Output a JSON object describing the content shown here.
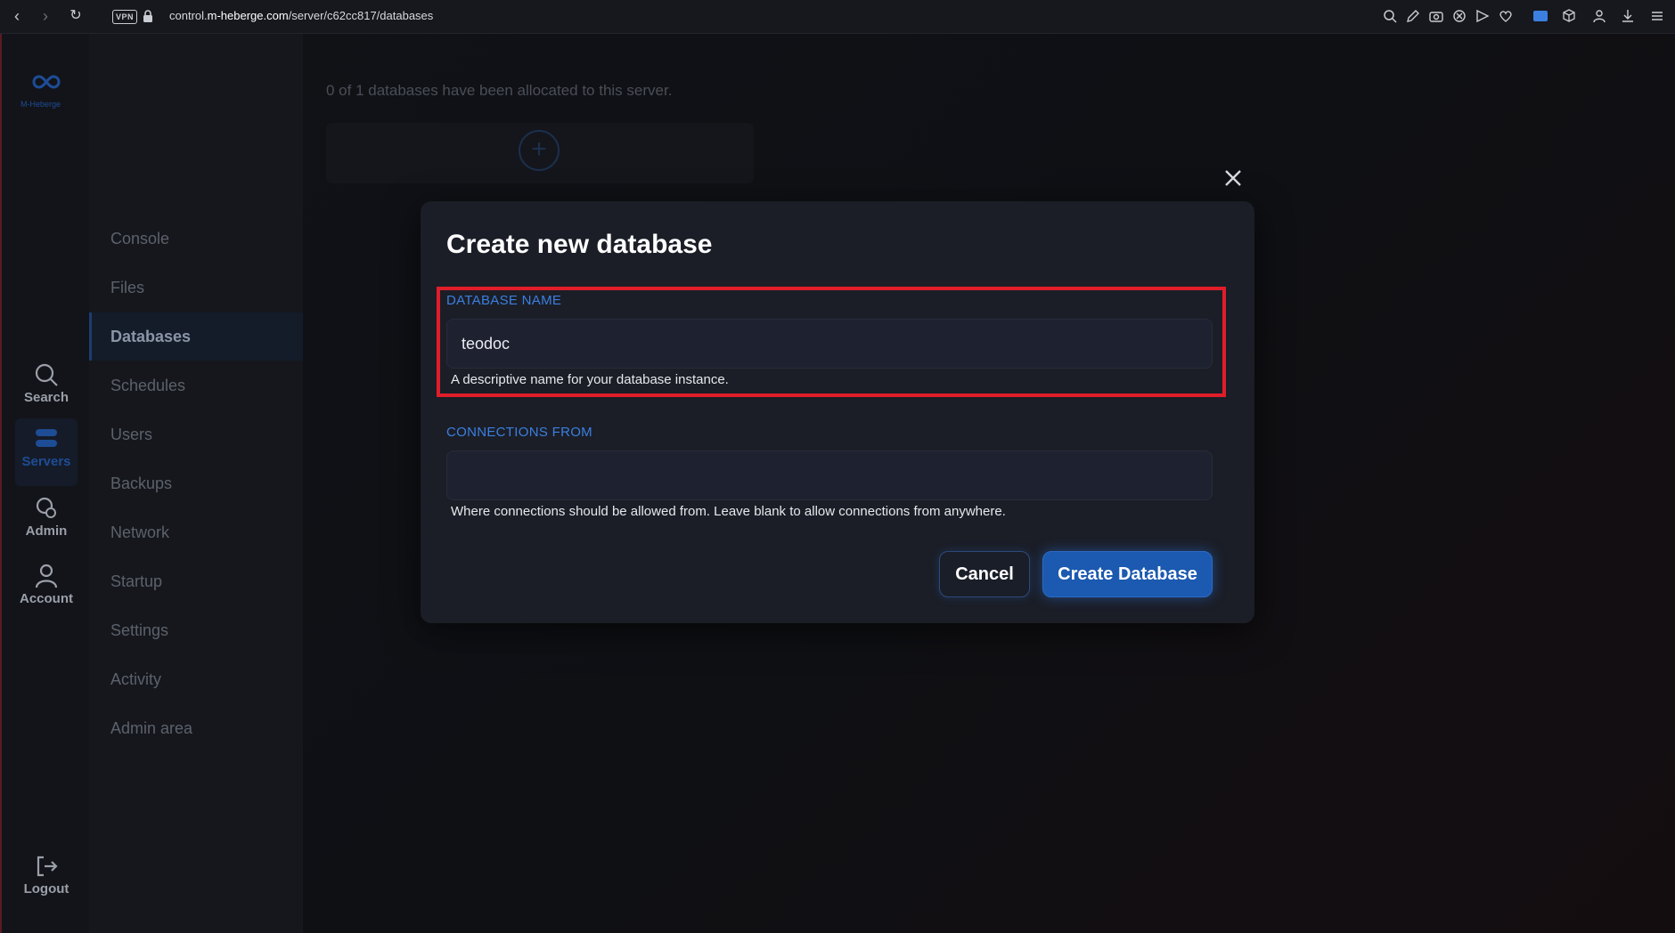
{
  "browser": {
    "vpn_label": "VPN",
    "url_prefix": "control.",
    "url_host": "m-heberge.com",
    "url_path": "/server/c62cc817/databases"
  },
  "brand": {
    "logo_text": "M-Heberge"
  },
  "rail": {
    "items": [
      {
        "label": "Search",
        "icon": "search-icon"
      },
      {
        "label": "Servers",
        "icon": "servers-icon"
      },
      {
        "label": "Admin",
        "icon": "admin-icon"
      },
      {
        "label": "Account",
        "icon": "account-icon"
      }
    ],
    "logout_label": "Logout"
  },
  "sidebar": {
    "items": [
      "Console",
      "Files",
      "Databases",
      "Schedules",
      "Users",
      "Backups",
      "Network",
      "Startup",
      "Settings",
      "Activity",
      "Admin area"
    ],
    "active": "Databases"
  },
  "content": {
    "allocation_text": "0 of 1 databases have been allocated to this server."
  },
  "modal": {
    "title": "Create new database",
    "db_name_label": "DATABASE NAME",
    "db_name_value": "teodoc",
    "db_name_help": "A descriptive name for your database instance.",
    "connections_label": "CONNECTIONS FROM",
    "connections_value": "",
    "connections_help": "Where connections should be allowed from. Leave blank to allow connections from anywhere.",
    "cancel_label": "Cancel",
    "create_label": "Create Database"
  },
  "colors": {
    "accent": "#1c59b0",
    "label_blue": "#3b7fe0",
    "highlight_red": "#e11d2a"
  }
}
